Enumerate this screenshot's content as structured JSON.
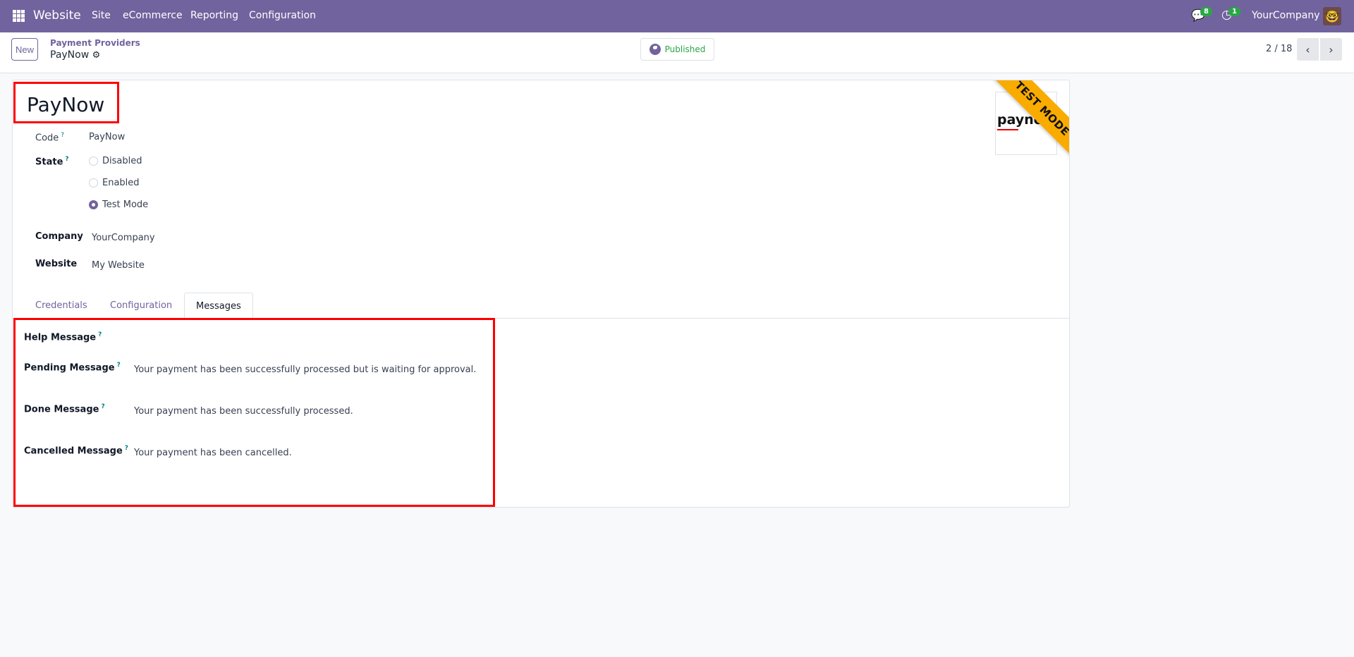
{
  "navbar": {
    "app": "Website",
    "menus": [
      "Site",
      "eCommerce",
      "Reporting",
      "Configuration"
    ],
    "messages_count": "8",
    "activities_count": "1",
    "company": "YourCompany"
  },
  "control_panel": {
    "new_label": "New",
    "breadcrumb_parent": "Payment Providers",
    "breadcrumb_current": "PayNow",
    "published_label": "Published",
    "pager": "2 / 18"
  },
  "form": {
    "name": "PayNow",
    "ribbon": "TEST MODE",
    "logo_text": "paynow",
    "code_label": "Code",
    "code_value": "PayNow",
    "state_label": "State",
    "state_options": [
      {
        "label": "Disabled",
        "selected": false
      },
      {
        "label": "Enabled",
        "selected": false
      },
      {
        "label": "Test Mode",
        "selected": true
      }
    ],
    "company_label": "Company",
    "company_value": "YourCompany",
    "website_label": "Website",
    "website_value": "My Website",
    "tabs": [
      "Credentials",
      "Configuration",
      "Messages"
    ],
    "active_tab": "Messages",
    "messages": [
      {
        "label": "Help Message",
        "value": ""
      },
      {
        "label": "Pending Message",
        "value": "Your payment has been successfully processed but is waiting for approval."
      },
      {
        "label": "Done Message",
        "value": "Your payment has been successfully processed."
      },
      {
        "label": "Cancelled Message",
        "value": "Your payment has been cancelled."
      }
    ],
    "help_mark": "?"
  },
  "colors": {
    "brand": "#71639e",
    "ribbon": "#f9ab00",
    "published": "#28a745",
    "highlight": "#ff0000"
  }
}
